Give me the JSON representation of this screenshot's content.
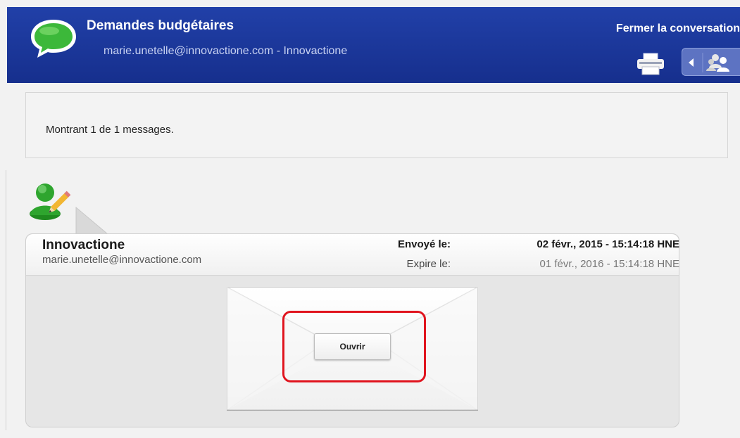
{
  "header": {
    "title": "Demandes budgétaires",
    "subtitle": "marie.unetelle@innovactione.com - Innovactione",
    "close_label": "Fermer la conversation",
    "icons": [
      "speech-bubble-icon",
      "printer-icon",
      "chevron-left-icon",
      "people-icon"
    ],
    "background_color": "#1b3aa0"
  },
  "info": {
    "text": "Montrant 1 de 1 messages."
  },
  "message": {
    "sender_name": "Innovactione",
    "sender_email": "marie.unetelle@innovactione.com",
    "sent_label": "Envoyé le:",
    "sent_value": "02 févr., 2015 - 15:14:18 HNE",
    "expires_label": "Expire le:",
    "expires_value": "01 févr., 2016 - 15:14:18 HNE",
    "open_label": "Ouvrir",
    "icons": [
      "user-edit-icon",
      "envelope-icon"
    ],
    "highlight_color": "#e0141e"
  }
}
